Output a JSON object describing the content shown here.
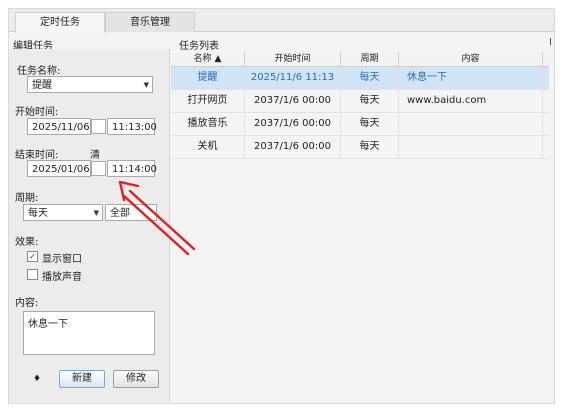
{
  "tabs": [
    {
      "label": "定时任务",
      "active": true
    },
    {
      "label": "音乐管理",
      "active": false
    }
  ],
  "left": {
    "title": "编辑任务",
    "task_name_label": "任务名称:",
    "task_name_value": "提醒",
    "start_label": "开始时间:",
    "start_date": "2025/11/06",
    "start_time": "11:13:00",
    "end_label": "结束时间:",
    "end_hint": "清",
    "end_date": "2025/01/06",
    "end_time": "11:14:00",
    "period_label": "周期:",
    "period_value": "每天",
    "period_scope": "全部",
    "effect_label": "效果:",
    "effects": [
      {
        "label": "显示窗口",
        "checked": true
      },
      {
        "label": "播放声音",
        "checked": false
      }
    ],
    "content_label": "内容:",
    "content_value": "休息一下",
    "new_button": "新建",
    "edit_button": "修改",
    "spin_glyph": "♦"
  },
  "list": {
    "title": "任务列表",
    "edge_char": "I",
    "headers": [
      "名称 ▲",
      "开始时间",
      "周期",
      "内容"
    ],
    "rows": [
      {
        "name": "提醒",
        "start": "2025/11/6 11:13",
        "period": "每天",
        "content": "休息一下",
        "selected": true
      },
      {
        "name": "打开网页",
        "start": "2037/1/6 00:00",
        "period": "每天",
        "content": "www.baidu.com",
        "selected": false
      },
      {
        "name": "播放音乐",
        "start": "2037/1/6 00:00",
        "period": "每天",
        "content": "",
        "selected": false
      },
      {
        "name": "关机",
        "start": "2037/1/6 00:00",
        "period": "每天",
        "content": "",
        "selected": false
      }
    ]
  },
  "colors": {
    "selected_row_bg": "#cfe5f6",
    "selected_text": "#2b6bb3",
    "annotation_arrow": "#e02020"
  }
}
